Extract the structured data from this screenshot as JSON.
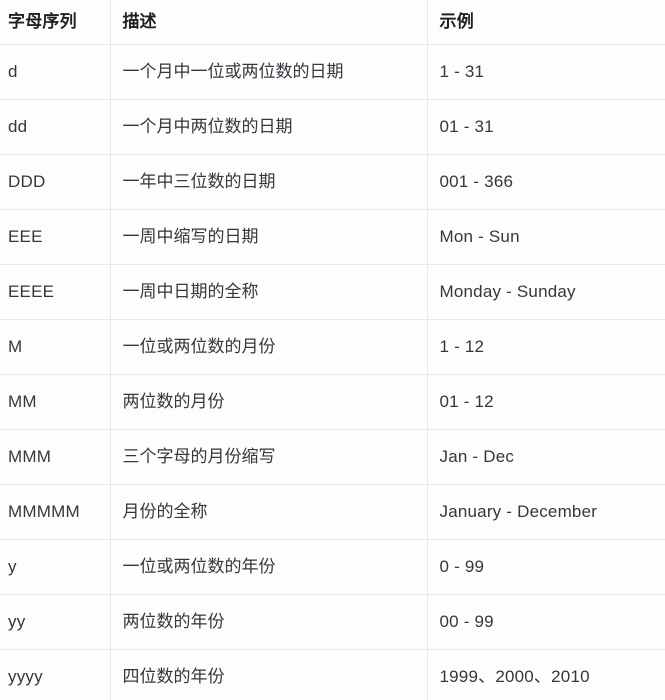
{
  "table": {
    "columns": [
      {
        "key": "token",
        "label": "字母序列"
      },
      {
        "key": "desc",
        "label": "描述"
      },
      {
        "key": "sample",
        "label": "示例"
      }
    ],
    "rows": [
      {
        "token": "d",
        "desc": "一个月中一位或两位数的日期",
        "sample": "1 - 31"
      },
      {
        "token": "dd",
        "desc": "一个月中两位数的日期",
        "sample": "01 - 31"
      },
      {
        "token": "DDD",
        "desc": "一年中三位数的日期",
        "sample": "001 - 366"
      },
      {
        "token": "EEE",
        "desc": "一周中缩写的日期",
        "sample": "Mon - Sun"
      },
      {
        "token": "EEEE",
        "desc": "一周中日期的全称",
        "sample": "Monday - Sunday"
      },
      {
        "token": "M",
        "desc": "一位或两位数的月份",
        "sample": "1 - 12"
      },
      {
        "token": "MM",
        "desc": "两位数的月份",
        "sample": "01 - 12"
      },
      {
        "token": "MMM",
        "desc": "三个字母的月份缩写",
        "sample": "Jan - Dec"
      },
      {
        "token": "MMMMM",
        "desc": "月份的全称",
        "sample": "January - December"
      },
      {
        "token": "y",
        "desc": "一位或两位数的年份",
        "sample": "0 - 99"
      },
      {
        "token": "yy",
        "desc": "两位数的年份",
        "sample": "00 - 99"
      },
      {
        "token": "yyyy",
        "desc": "四位数的年份",
        "sample": "1999、2000、2010"
      }
    ]
  },
  "colors": {
    "background": "#fdfdfd",
    "divider": "#e7e8e9",
    "header_text": "#1e2124",
    "body_text": "#33383d"
  }
}
